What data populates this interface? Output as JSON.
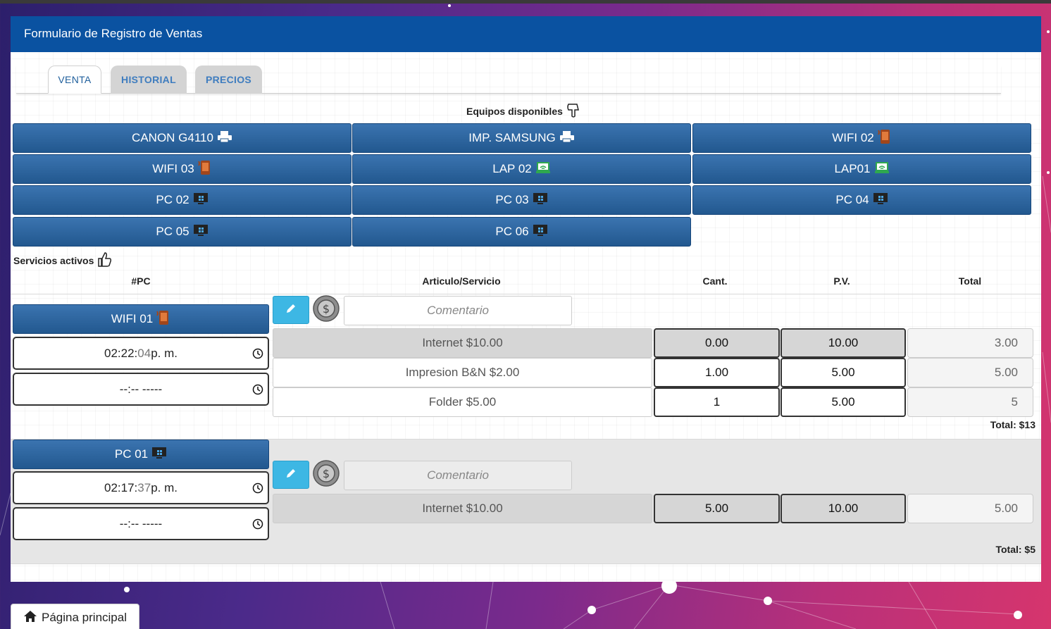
{
  "header": {
    "title": "Formulario de Registro de Ventas"
  },
  "tabs": [
    {
      "label": "VENTA",
      "active": true
    },
    {
      "label": "HISTORIAL",
      "active": false
    },
    {
      "label": "PRECIOS",
      "active": false
    }
  ],
  "equipment": {
    "title": "Equipos disponibles",
    "title_icon": "hand-point-down-icon",
    "items": [
      {
        "label": "CANON G4110",
        "icon": "printer-icon"
      },
      {
        "label": "IMP. SAMSUNG",
        "icon": "printer-icon"
      },
      {
        "label": "WIFI 02",
        "icon": "phone-icon"
      },
      {
        "label": "WIFI 03",
        "icon": "phone-icon"
      },
      {
        "label": "LAP 02",
        "icon": "laptop-wifi-icon"
      },
      {
        "label": "LAP01",
        "icon": "laptop-wifi-icon"
      },
      {
        "label": "PC 02",
        "icon": "monitor-icon"
      },
      {
        "label": "PC 03",
        "icon": "monitor-icon"
      },
      {
        "label": "PC 04",
        "icon": "monitor-icon"
      },
      {
        "label": "PC 05",
        "icon": "monitor-icon"
      },
      {
        "label": "PC 06",
        "icon": "monitor-icon"
      }
    ]
  },
  "services": {
    "title": "Servicios activos",
    "title_icon": "thumbs-up-icon",
    "columns": {
      "pc": "#PC",
      "article": "Articulo/Servicio",
      "qty": "Cant.",
      "price": "P.V.",
      "total": "Total"
    },
    "comment_placeholder": "Comentario",
    "entries": [
      {
        "pc": "WIFI 01",
        "pc_icon": "phone-icon",
        "start_time": {
          "hm": "02:22:",
          "sec": "04",
          "ampm": " p. m."
        },
        "end_time": "--:-- -----",
        "lines": [
          {
            "article": "Internet $10.00",
            "qty": "0.00",
            "price": "10.00",
            "total": "3.00"
          },
          {
            "article": "Impresion B&N $2.00",
            "qty": "1.00",
            "price": "5.00",
            "total": "5.00"
          },
          {
            "article": "Folder $5.00",
            "qty": "1",
            "price": "5.00",
            "total": "5"
          }
        ],
        "total_label": "Total: $13"
      },
      {
        "pc": "PC 01",
        "pc_icon": "monitor-icon",
        "start_time": {
          "hm": "02:17:",
          "sec": "37",
          "ampm": " p. m."
        },
        "end_time": "--:-- -----",
        "lines": [
          {
            "article": "Internet $10.00",
            "qty": "5.00",
            "price": "10.00",
            "total": "5.00"
          }
        ],
        "total_label": "Total: $5"
      }
    ]
  },
  "footer": {
    "home_label": "Página principal",
    "home_icon": "home-icon"
  },
  "colors": {
    "header": "#0a52a1",
    "equip_button": "#2a64a0",
    "edit_button": "#3db7e4"
  }
}
